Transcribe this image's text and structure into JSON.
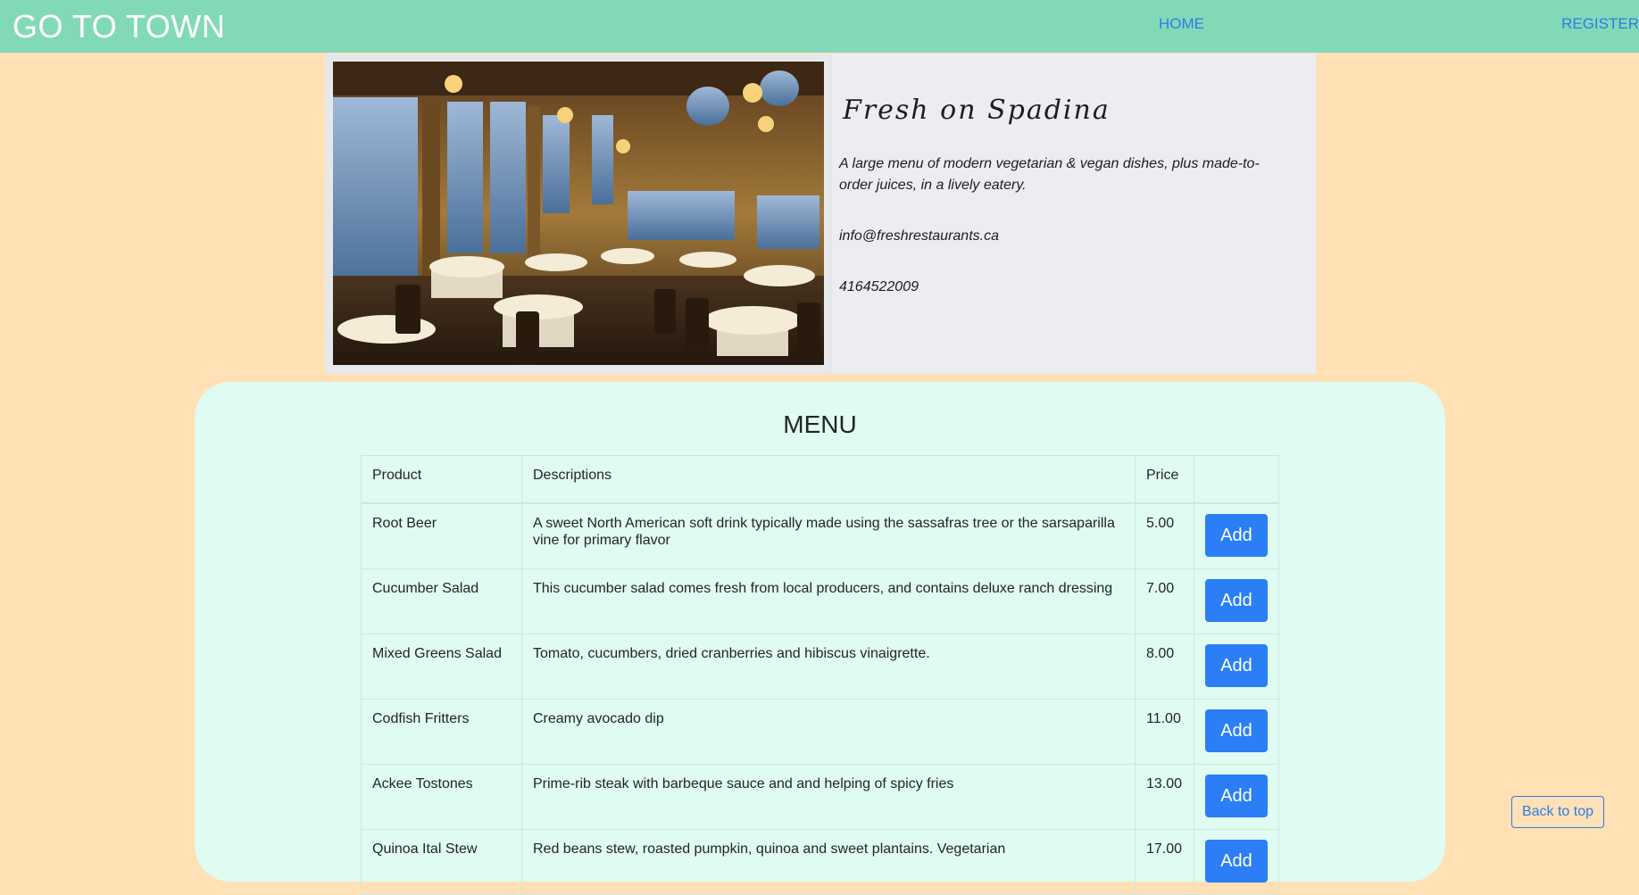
{
  "nav": {
    "brand": "GO TO TOWN",
    "home": "HOME",
    "register": "REGISTER"
  },
  "restaurant": {
    "name": "Fresh on Spadina",
    "description": "A large menu of modern vegetarian & vegan dishes, plus made-to-order juices, in a lively eatery.",
    "email": "info@freshrestaurants.ca",
    "phone": "4164522009",
    "photo_icon": "restaurant-dining-room-photo"
  },
  "menu": {
    "title": "MENU",
    "headers": [
      "Product",
      "Descriptions",
      "Price",
      ""
    ],
    "add_label": "Add",
    "rows": [
      {
        "product": "Root Beer",
        "description": "A sweet North American soft drink typically made using the sassafras tree or the sarsaparilla vine for primary flavor",
        "price": "5.00"
      },
      {
        "product": "Cucumber Salad",
        "description": "This cucumber salad comes fresh from local producers, and contains deluxe ranch dressing",
        "price": "7.00"
      },
      {
        "product": "Mixed Greens Salad",
        "description": "Tomato, cucumbers, dried cranberries and hibiscus vinaigrette.",
        "price": "8.00"
      },
      {
        "product": "Codfish Fritters",
        "description": "Creamy avocado dip",
        "price": "11.00"
      },
      {
        "product": "Ackee Tostones",
        "description": "Prime-rib steak with barbeque sauce and and helping of spicy fries",
        "price": "13.00"
      },
      {
        "product": "Quinoa Ital Stew",
        "description": "Red beans stew, roasted pumpkin, quinoa and sweet plantains. Vegetarian",
        "price": "17.00"
      }
    ]
  },
  "back_to_top": "Back to top",
  "colors": {
    "navbar": "#82d9b8",
    "page_bg": "#ffe1b5",
    "menu_panel": "#e0fbf1",
    "button": "#2b7ef5",
    "link": "#2b7de9"
  }
}
